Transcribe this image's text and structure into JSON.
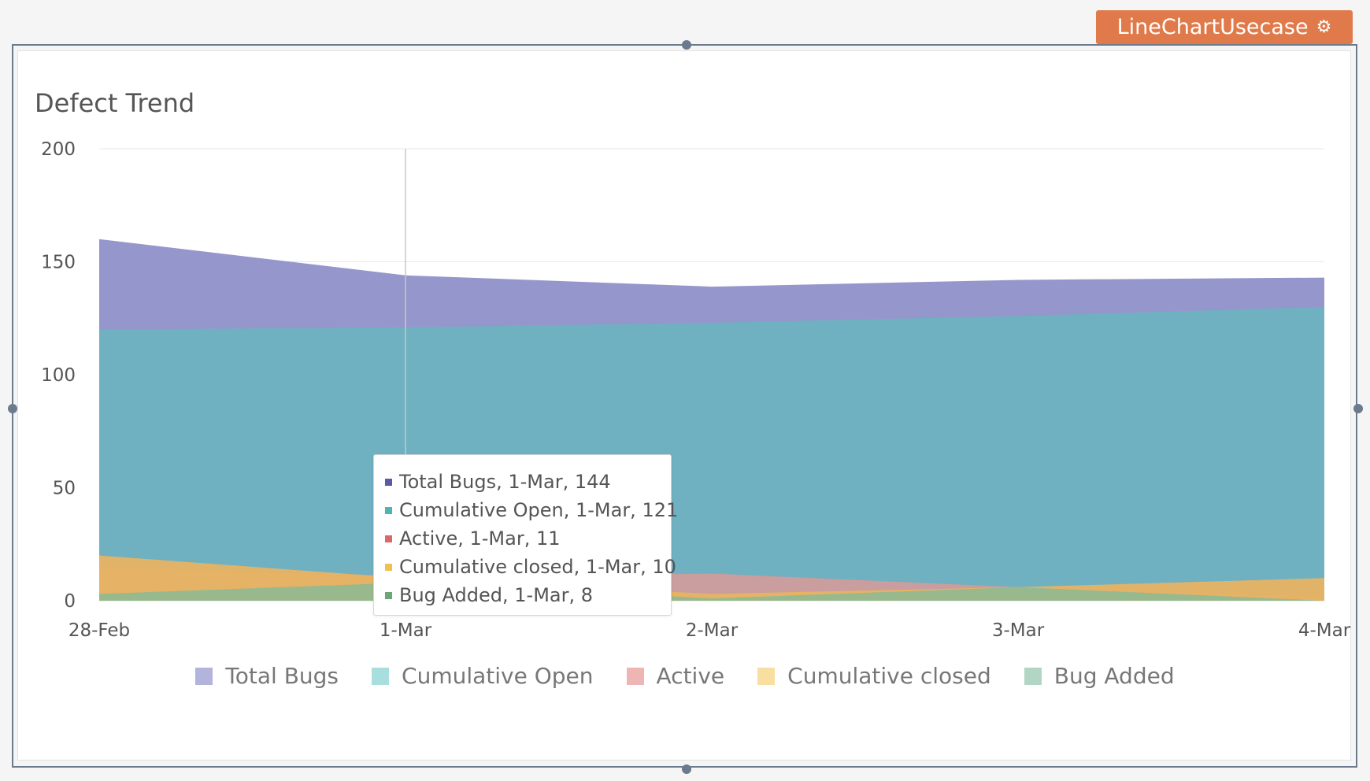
{
  "widget": {
    "name": "LineChartUsecase",
    "settings_icon": "gear-icon",
    "accent": "#e07a4a"
  },
  "chart_data": {
    "type": "area",
    "title": "Defect Trend",
    "xlabel": "",
    "ylabel": "",
    "categories": [
      "28-Feb",
      "1-Mar",
      "2-Mar",
      "3-Mar",
      "4-Mar"
    ],
    "ylim": [
      0,
      200
    ],
    "yticks": [
      0,
      50,
      100,
      150,
      200
    ],
    "grid": true,
    "stacked": false,
    "legend_position": "bottom",
    "series": [
      {
        "name": "Total Bugs",
        "values": [
          160,
          144,
          139,
          142,
          143
        ],
        "color": "#8f91c9",
        "swatch": "#b3b4dc",
        "marker": "#5a5aa8"
      },
      {
        "name": "Cumulative Open",
        "values": [
          120,
          121,
          123,
          126,
          130
        ],
        "color": "#6db1c0",
        "swatch": "#a9dedf",
        "marker": "#4fb5b3"
      },
      {
        "name": "Active",
        "values": [
          15,
          11,
          12,
          6,
          2
        ],
        "color": "#cf9c9c",
        "swatch": "#efb5b5",
        "marker": "#d9676b"
      },
      {
        "name": "Cumulative closed",
        "values": [
          20,
          10,
          3,
          6,
          10
        ],
        "color": "#e6b363",
        "swatch": "#f8dea1",
        "marker": "#f2c14c"
      },
      {
        "name": "Bug Added",
        "values": [
          3,
          8,
          1,
          6,
          0
        ],
        "color": "#93b98f",
        "swatch": "#b2d6c4",
        "marker": "#6aa87a"
      }
    ],
    "tooltip": {
      "category": "1-Mar",
      "rows": [
        "Total Bugs, 1-Mar, 144",
        "Cumulative Open, 1-Mar, 121",
        "Active, 1-Mar, 11",
        "Cumulative closed, 1-Mar, 10",
        "Bug Added, 1-Mar, 8"
      ]
    }
  }
}
